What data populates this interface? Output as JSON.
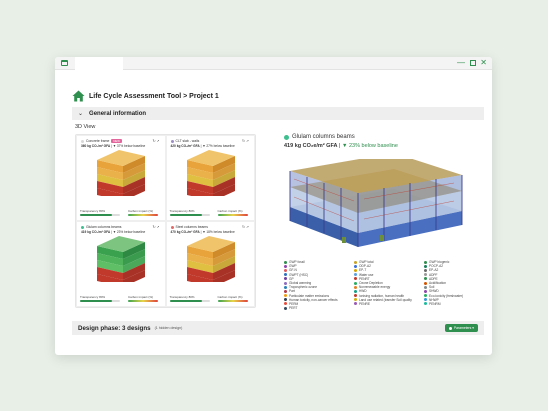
{
  "window": {
    "controls": {
      "minimize": "—",
      "close": "✕"
    }
  },
  "header": {
    "title": "Life Cycle Assessment Tool > Project 1"
  },
  "section": {
    "title": "General information",
    "chevron": "⌄"
  },
  "view_label": "3D View",
  "tiles": [
    {
      "name": "Concrete frame",
      "badge": "NEW",
      "dot_color": "#d9d9d9",
      "metric_value": "360 kg CO₂/m² GFA",
      "metric_note": "| ▼ 37% below baseline",
      "transparency_label": "Transparency 80%",
      "impact_label": "Carbon impact (%)",
      "scheme": "warm"
    },
    {
      "name": "CLT slab - walls",
      "badge": "",
      "dot_color": "#9b8ec4",
      "metric_value": "420 kg CO₂/m² GFA",
      "metric_note": "| ▼ 27% below baseline",
      "transparency_label": "Transparency 80%",
      "impact_label": "Carbon impact (%)",
      "scheme": "warm"
    },
    {
      "name": "Glulam columns beams",
      "badge": "",
      "dot_color": "#3fbf8f",
      "metric_value": "419 kg CO₂/m² GFA",
      "metric_note": "| ▼ 23% below baseline",
      "transparency_label": "Transparency 80%",
      "impact_label": "Carbon impact (%)",
      "scheme": "green"
    },
    {
      "name": "Steel columns beams",
      "badge": "",
      "dot_color": "#e06a6a",
      "metric_value": "470 kg CO₂/m² GFA",
      "metric_note": "| ▼ 18% below baseline",
      "transparency_label": "Transparency 80%",
      "impact_label": "Carbon impact (%)",
      "scheme": "warm"
    }
  ],
  "detail": {
    "name": "Glulam columns beams",
    "dot_color": "#3fbf8f",
    "metric_value": "419 kg CO₂e/m² GFA",
    "metric_sep": "|",
    "metric_note": "▼ 23% below baseline"
  },
  "legend": [
    {
      "label": "GWP fossil",
      "color": "#2f8f4e"
    },
    {
      "label": "GWP total",
      "color": "#c9a227"
    },
    {
      "label": "GWP biogenic",
      "color": "#2f8f4e"
    },
    {
      "label": "GWP",
      "color": "#8e44ad"
    },
    {
      "label": "ODP-A2",
      "color": "#3b6fd8"
    },
    {
      "label": "POCP-A2",
      "color": "#1a7f5a"
    },
    {
      "label": "GF-N",
      "color": "#e05a5a"
    },
    {
      "label": "EP-T",
      "color": "#d9a400"
    },
    {
      "label": "EP-A2",
      "color": "#6a6a6a"
    },
    {
      "label": "GWPT (HSC)",
      "color": "#2f6fbf"
    },
    {
      "label": "Water use",
      "color": "#5aa0e0"
    },
    {
      "label": "ADPF",
      "color": "#999999"
    },
    {
      "label": "GP",
      "color": "#6b3fa0"
    },
    {
      "label": "PENRT",
      "color": "#c0392b"
    },
    {
      "label": "ADPE",
      "color": "#2f8f4e"
    },
    {
      "label": "Global warming",
      "color": "#8e6bbf"
    },
    {
      "label": "Ozone Depletion",
      "color": "#27ae60"
    },
    {
      "label": "Acidification",
      "color": "#d35400"
    },
    {
      "label": "Tropospheric ozone",
      "color": "#2980b9"
    },
    {
      "label": "Nonrenewable energy",
      "color": "#e67e22"
    },
    {
      "label": "Soil",
      "color": "#7f8c8d"
    },
    {
      "label": "Part",
      "color": "#b03a48"
    },
    {
      "label": "HWD",
      "color": "#16a085"
    },
    {
      "label": "SHWD",
      "color": "#8e44ad"
    },
    {
      "label": "Particulate matter emissions",
      "color": "#f39c12"
    },
    {
      "label": "Ionising radiation, human health",
      "color": "#c0392b"
    },
    {
      "label": "Eco-toxicity (freshwater)",
      "color": "#27ae60"
    },
    {
      "label": "Human toxicity, non-cancer effects",
      "color": "#2c3e50"
    },
    {
      "label": "Land use related (transfer Soil quality",
      "color": "#d4ac0d"
    },
    {
      "label": "NHWP",
      "color": "#3498db"
    },
    {
      "label": "PERM",
      "color": "#e74c3c"
    },
    {
      "label": "PENRE",
      "color": "#9b59b6"
    },
    {
      "label": "PENRM",
      "color": "#1abc9c"
    },
    {
      "label": "PERT",
      "color": "#34495e"
    },
    {
      "label": "",
      "color": ""
    },
    {
      "label": "",
      "color": ""
    }
  ],
  "footer": {
    "title": "Design phase: 3 designs",
    "subtitle": "(1 hidden design)",
    "parameters_button": "Parameters ▾"
  }
}
